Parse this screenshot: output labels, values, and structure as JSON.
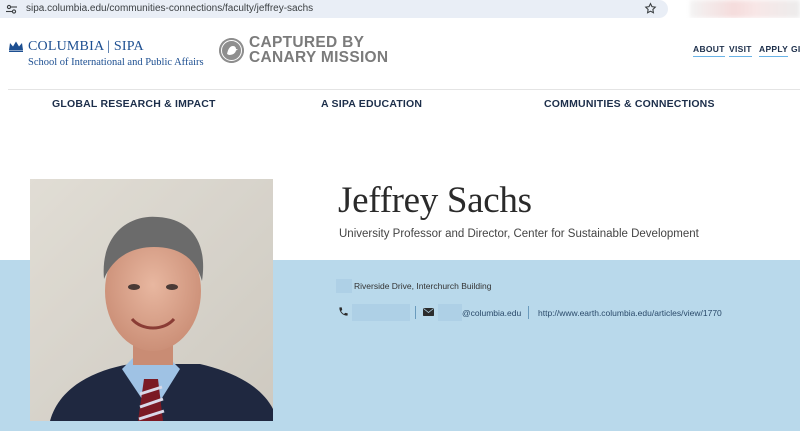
{
  "browser": {
    "url": "sipa.columbia.edu/communities-connections/faculty/jeffrey-sachs"
  },
  "header": {
    "brand_name": "COLUMBIA | SIPA",
    "brand_sub": "School of International and Public Affairs",
    "overlay_line1": "CAPTURED BY",
    "overlay_line2": "CANARY MISSION",
    "utility_nav": [
      "ABOUT",
      "VISIT",
      "APPLY",
      "GIV"
    ]
  },
  "main_nav": [
    "GLOBAL RESEARCH & IMPACT",
    "A SIPA EDUCATION",
    "COMMUNITIES & CONNECTIONS"
  ],
  "profile": {
    "name": "Jeffrey Sachs",
    "title": "University Professor and Director, Center for Sustainable Development",
    "address": "Riverside Drive, Interchurch Building",
    "email_suffix": "@columbia.edu",
    "website": "http://www.earth.columbia.edu/articles/view/1770"
  },
  "colors": {
    "columbia_blue": "#b9d9eb",
    "brand_navy": "#1d4f91",
    "nav_text": "#1c2e4a"
  },
  "icons": [
    "tune-icon",
    "star-icon",
    "crown-icon",
    "canary-logo-icon",
    "phone-icon",
    "mail-icon"
  ]
}
